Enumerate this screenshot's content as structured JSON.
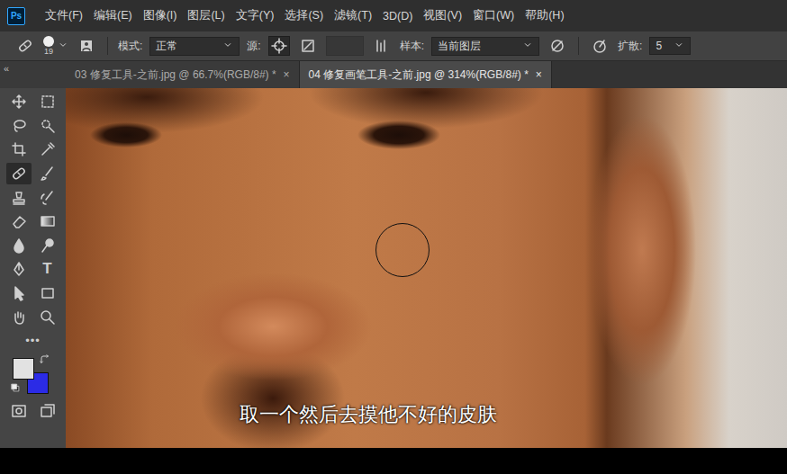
{
  "app_logo": "Ps",
  "menu": {
    "items": [
      "文件(F)",
      "编辑(E)",
      "图像(I)",
      "图层(L)",
      "文字(Y)",
      "选择(S)",
      "滤镜(T)",
      "3D(D)",
      "视图(V)",
      "窗口(W)",
      "帮助(H)"
    ]
  },
  "options": {
    "brush_size": "19",
    "mode_label": "模式:",
    "mode_value": "正常",
    "source_label": "源:",
    "source_sampled": true,
    "sample_label": "样本:",
    "sample_value": "当前图层",
    "diffusion_label": "扩散:",
    "diffusion_value": "5"
  },
  "toolbar": {
    "collapse": "«",
    "more": "•••"
  },
  "tabs": [
    {
      "label": "03 修复工具-之前.jpg @ 66.7%(RGB/8#) *",
      "close": "×",
      "selected": false
    },
    {
      "label": "04 修复画笔工具-之前.jpg @ 314%(RGB/8#) *",
      "close": "×",
      "selected": true
    }
  ],
  "tools": [
    {
      "kind": "icon",
      "selected": false
    },
    {
      "kind": "icon",
      "selected": false
    },
    {
      "kind": "icon",
      "selected": false
    },
    {
      "kind": "icon",
      "selected": false
    },
    {
      "kind": "icon",
      "selected": false
    },
    {
      "kind": "icon",
      "selected": false
    },
    {
      "kind": "icon",
      "selected": true
    },
    {
      "kind": "icon",
      "selected": false
    },
    {
      "kind": "icon",
      "selected": false
    },
    {
      "kind": "icon",
      "selected": false
    },
    {
      "kind": "icon",
      "selected": false
    },
    {
      "kind": "icon",
      "selected": false
    },
    {
      "kind": "icon",
      "selected": false
    },
    {
      "kind": "icon",
      "selected": false
    },
    {
      "kind": "icon",
      "selected": false
    },
    {
      "kind": "glyph",
      "label": "T",
      "selected": false
    },
    {
      "kind": "icon",
      "selected": false
    },
    {
      "kind": "icon",
      "selected": false
    },
    {
      "kind": "icon",
      "selected": false
    },
    {
      "kind": "icon",
      "selected": false
    }
  ],
  "swatches": {
    "foreground": "#e2e2e2",
    "background": "#2b2be6"
  },
  "subtitle": "取一个然后去摸他不好的皮肤"
}
